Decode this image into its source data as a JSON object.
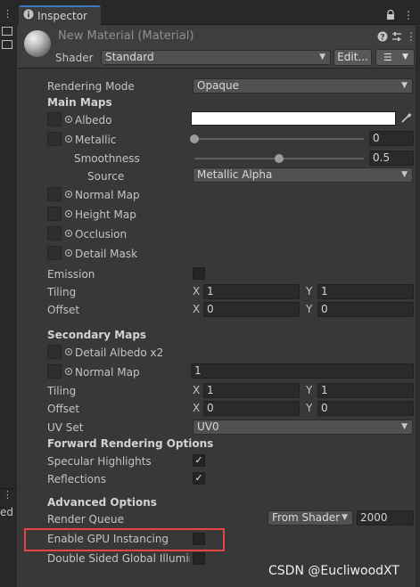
{
  "window": {
    "tab_label": "Inspector"
  },
  "material": {
    "title": "New Material (Material)",
    "shader_label": "Shader",
    "shader_value": "Standard",
    "edit_label": "Edit..."
  },
  "rendering_mode": {
    "label": "Rendering Mode",
    "value": "Opaque"
  },
  "main_maps": {
    "heading": "Main Maps",
    "albedo": "Albedo",
    "metallic": "Metallic",
    "metallic_value": "0",
    "metallic_level": 0,
    "smoothness": "Smoothness",
    "smoothness_value": "0.5",
    "smoothness_level": 0.5,
    "source": "Source",
    "source_value": "Metallic Alpha",
    "normal_map": "Normal Map",
    "height_map": "Height Map",
    "occlusion": "Occlusion",
    "detail_mask": "Detail Mask",
    "emission": "Emission",
    "tiling": "Tiling",
    "offset": "Offset",
    "tiling_x": "1",
    "tiling_y": "1",
    "offset_x": "0",
    "offset_y": "0"
  },
  "secondary_maps": {
    "heading": "Secondary Maps",
    "detail_albedo": "Detail Albedo x2",
    "normal_map": "Normal Map",
    "normal_value": "1",
    "tiling": "Tiling",
    "offset": "Offset",
    "tiling_x": "1",
    "tiling_y": "1",
    "offset_x": "0",
    "offset_y": "0",
    "uv_set": "UV Set",
    "uv_value": "UV0"
  },
  "forward_rendering": {
    "heading": "Forward Rendering Options",
    "specular_highlights": "Specular Highlights",
    "specular_checked": true,
    "reflections": "Reflections",
    "reflections_checked": true
  },
  "advanced": {
    "heading": "Advanced Options",
    "render_queue": "Render Queue",
    "render_queue_mode": "From Shader",
    "render_queue_value": "2000",
    "gpu_instancing": "Enable GPU Instancing",
    "double_sided": "Double Sided Global Illuminat"
  },
  "axis": {
    "x": "X",
    "y": "Y"
  },
  "left_panel": {
    "fragment": "ed"
  },
  "watermark": "CSDN @EucliwoodXT",
  "colors": {
    "highlight": "#e34444",
    "accent": "#3a79bb"
  }
}
